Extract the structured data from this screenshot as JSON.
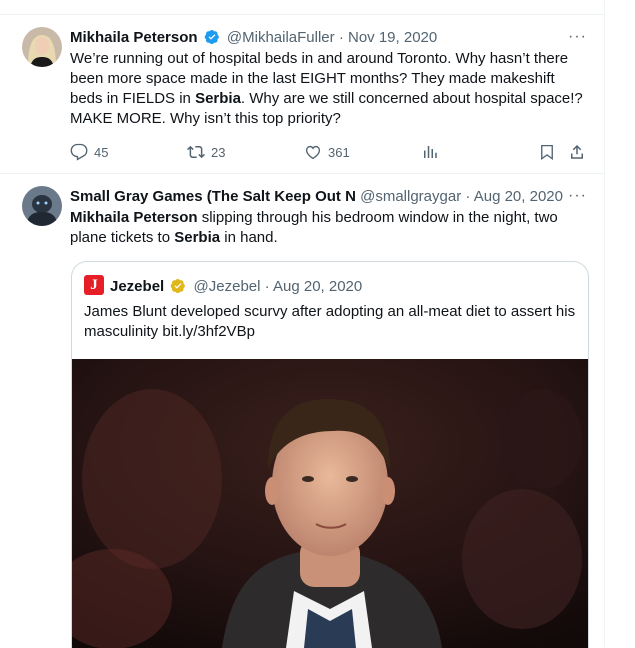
{
  "tweets": [
    {
      "name": "Mikhaila Peterson",
      "handle": "@MikhailaFuller",
      "separator": "·",
      "date": "Nov 19, 2020",
      "text_parts": [
        "We’re running out of hospital beds in and around Toronto. Why hasn’t there been more space made in the last EIGHT months? They made makeshift beds in FIELDS in ",
        "Serbia",
        ". Why are we still concerned about hospital space!? MAKE MORE. Why isn’t this top priority?"
      ],
      "replies": "45",
      "retweets": "23",
      "likes": "361",
      "more": "···"
    },
    {
      "name": "Small Gray Games (The Salt Keep Out N",
      "handle": "@smallgraygar",
      "separator": "·",
      "date": "Aug 20, 2020",
      "text_parts": [
        "Mikhaila Peterson",
        " slipping through his bedroom window in the night, two plane tickets to ",
        "Serbia",
        " in hand."
      ],
      "more": "···",
      "quote": {
        "logo_letter": "J",
        "name": "Jezebel",
        "handle": "@Jezebel",
        "separator": "·",
        "date": "Aug 20, 2020",
        "text": "James Blunt developed scurvy after adopting an all-meat diet to assert his masculinity bit.ly/3hf2VBp"
      }
    }
  ],
  "top_more": "···",
  "colors": {
    "text": "#0f1419",
    "secondary": "#536471",
    "verified_blue": "#1d9bf0",
    "verified_gold": "#e2b719",
    "border": "#cfd9de",
    "jezebel_red": "#e61e28"
  },
  "icons": [
    "reply-icon",
    "retweet-icon",
    "like-icon",
    "views-icon",
    "bookmark-icon",
    "share-icon",
    "verified-badge-icon"
  ]
}
